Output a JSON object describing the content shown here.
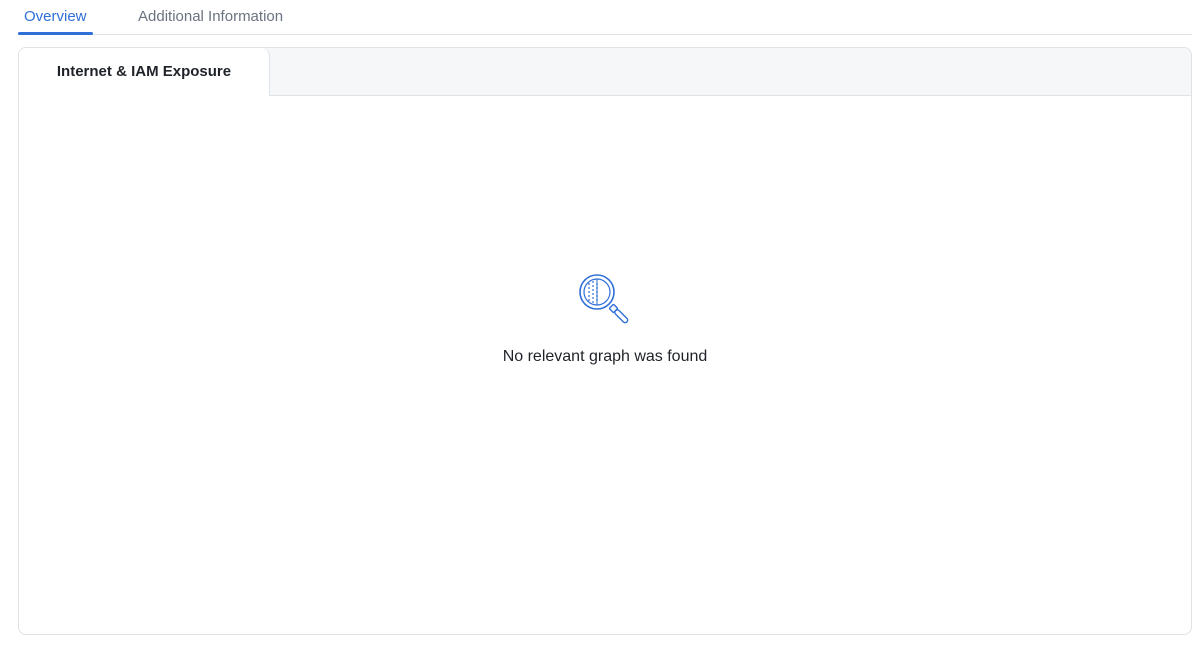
{
  "top_tabs": [
    {
      "label": "Overview",
      "active": true
    },
    {
      "label": "Additional Information",
      "active": false
    }
  ],
  "panel": {
    "tab_label": "Internet & IAM Exposure",
    "empty_state": {
      "icon": "magnifier-icon",
      "message": "No relevant graph was found"
    }
  },
  "colors": {
    "accent": "#2e6fd8",
    "border": "#dfe2e7",
    "header_bg": "#f6f7f9",
    "text": "#1f2329",
    "muted": "#6b7280"
  }
}
